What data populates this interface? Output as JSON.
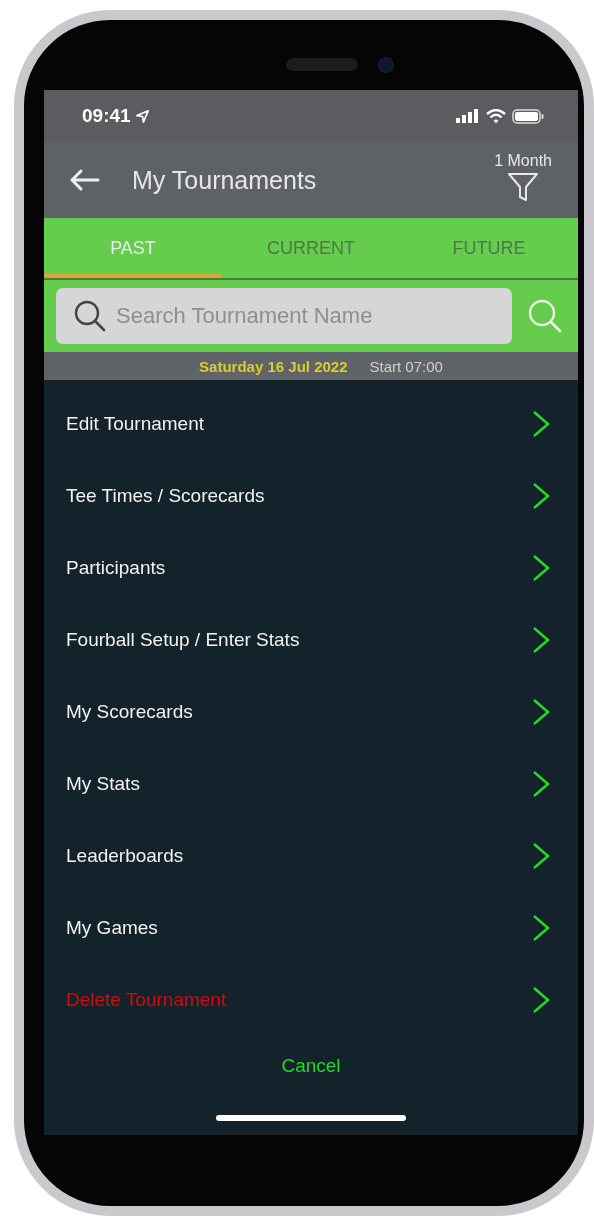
{
  "status_bar": {
    "time": "09:41"
  },
  "header": {
    "title": "My Tournaments",
    "filter_label": "1 Month"
  },
  "tabs": [
    {
      "label": "PAST",
      "selected": true
    },
    {
      "label": "CURRENT",
      "selected": false
    },
    {
      "label": "FUTURE",
      "selected": false
    }
  ],
  "search": {
    "placeholder": "Search Tournament Name"
  },
  "list_row": {
    "date": "Saturday 16 Jul 2022",
    "start": "Start 07:00"
  },
  "action_sheet": {
    "items": [
      {
        "label": "Edit Tournament",
        "kind": "normal"
      },
      {
        "label": "Tee Times / Scorecards",
        "kind": "normal"
      },
      {
        "label": "Participants",
        "kind": "normal"
      },
      {
        "label": "Fourball Setup / Enter Stats",
        "kind": "normal"
      },
      {
        "label": "My Scorecards",
        "kind": "normal"
      },
      {
        "label": "My Stats",
        "kind": "normal"
      },
      {
        "label": "Leaderboards",
        "kind": "normal"
      },
      {
        "label": "My Games",
        "kind": "normal"
      },
      {
        "label": "Delete Tournament",
        "kind": "destructive"
      }
    ],
    "cancel": "Cancel"
  }
}
